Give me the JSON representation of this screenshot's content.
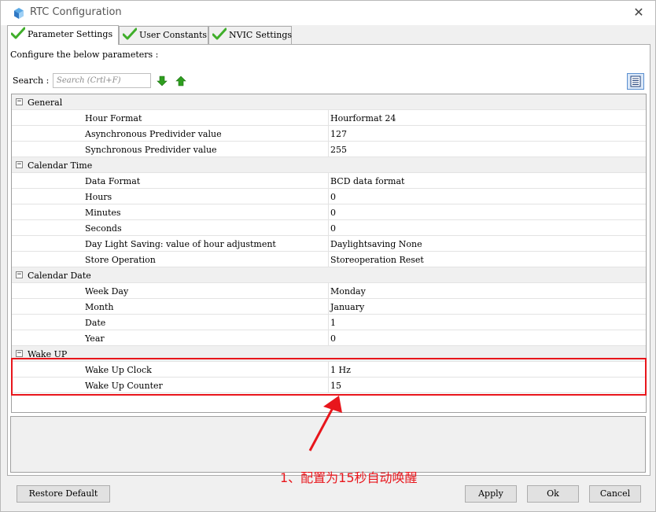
{
  "window": {
    "title": "RTC Configuration"
  },
  "tabs": [
    {
      "label": "Parameter Settings",
      "active": true
    },
    {
      "label": "User Constants",
      "active": false
    },
    {
      "label": "NVIC Settings",
      "active": false
    }
  ],
  "panel": {
    "configure_label": "Configure the below parameters :",
    "search_label": "Search :",
    "search_placeholder": "Search (Crtl+F)"
  },
  "groups": [
    {
      "name": "General",
      "params": [
        {
          "name": "Hour Format",
          "value": "Hourformat 24"
        },
        {
          "name": "Asynchronous Predivider value",
          "value": "127"
        },
        {
          "name": "Synchronous Predivider value",
          "value": "255"
        }
      ]
    },
    {
      "name": "Calendar Time",
      "params": [
        {
          "name": "Data Format",
          "value": "BCD data format"
        },
        {
          "name": "Hours",
          "value": "0"
        },
        {
          "name": "Minutes",
          "value": "0"
        },
        {
          "name": "Seconds",
          "value": "0"
        },
        {
          "name": "Day Light Saving: value of hour adjustment",
          "value": "Daylightsaving None"
        },
        {
          "name": "Store Operation",
          "value": "Storeoperation Reset"
        }
      ]
    },
    {
      "name": "Calendar Date",
      "params": [
        {
          "name": "Week Day",
          "value": "Monday"
        },
        {
          "name": "Month",
          "value": "January"
        },
        {
          "name": "Date",
          "value": "1"
        },
        {
          "name": "Year",
          "value": "0"
        }
      ]
    },
    {
      "name": "Wake UP",
      "params": [
        {
          "name": "Wake Up Clock",
          "value": "1 Hz"
        },
        {
          "name": "Wake Up Counter",
          "value": "15"
        }
      ]
    }
  ],
  "annotation": {
    "text": "1、配置为15秒自动唤醒",
    "color": "#e8161c"
  },
  "buttons": {
    "restore_default": "Restore Default",
    "apply": "Apply",
    "ok": "Ok",
    "cancel": "Cancel"
  },
  "colors": {
    "check_green": "#3fae2a",
    "highlight_red": "#e8161c",
    "arrow_green": "#2e9e1f"
  }
}
